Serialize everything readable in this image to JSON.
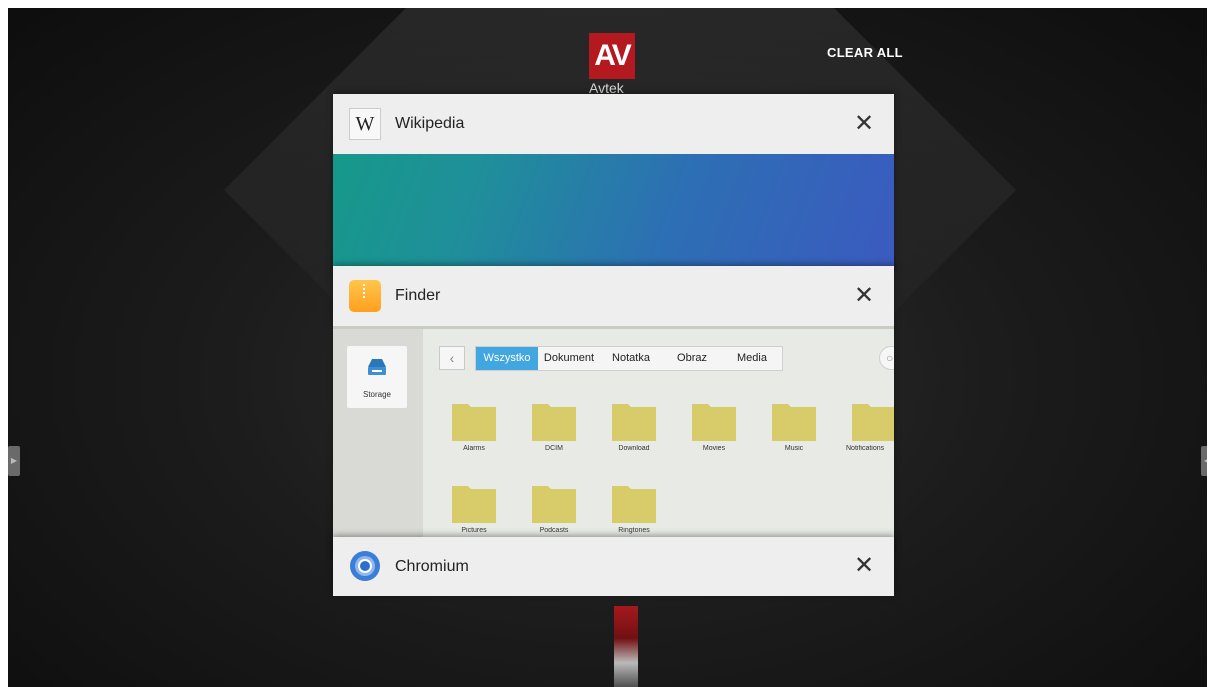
{
  "clear_all_label": "CLEAR ALL",
  "brand": {
    "logo_text": "AV",
    "logo_sub": "Avtek",
    "color": "#b3191e"
  },
  "cards": {
    "wikipedia": {
      "title": "Wikipedia",
      "icon": "wikipedia-w-icon",
      "icon_glyph": "W"
    },
    "finder": {
      "title": "Finder",
      "icon": "finder-zip-icon"
    },
    "chromium": {
      "title": "Chromium",
      "icon": "chromium-icon"
    }
  },
  "close_glyph": "✕",
  "finder": {
    "sidebar": {
      "storage_label": "Storage"
    },
    "back_glyph": "‹",
    "tabs": [
      "Wszystko",
      "Dokument",
      "Notatka",
      "Obraz",
      "Media"
    ],
    "active_tab": "Wszystko",
    "folders": [
      "Alarms",
      "DCIM",
      "Download",
      "Movies",
      "Music",
      "Notifications",
      "Pictures",
      "Podcasts",
      "Ringtones"
    ],
    "colors": {
      "folder": "#d8cb6a",
      "active_tab": "#42a6e0"
    }
  }
}
